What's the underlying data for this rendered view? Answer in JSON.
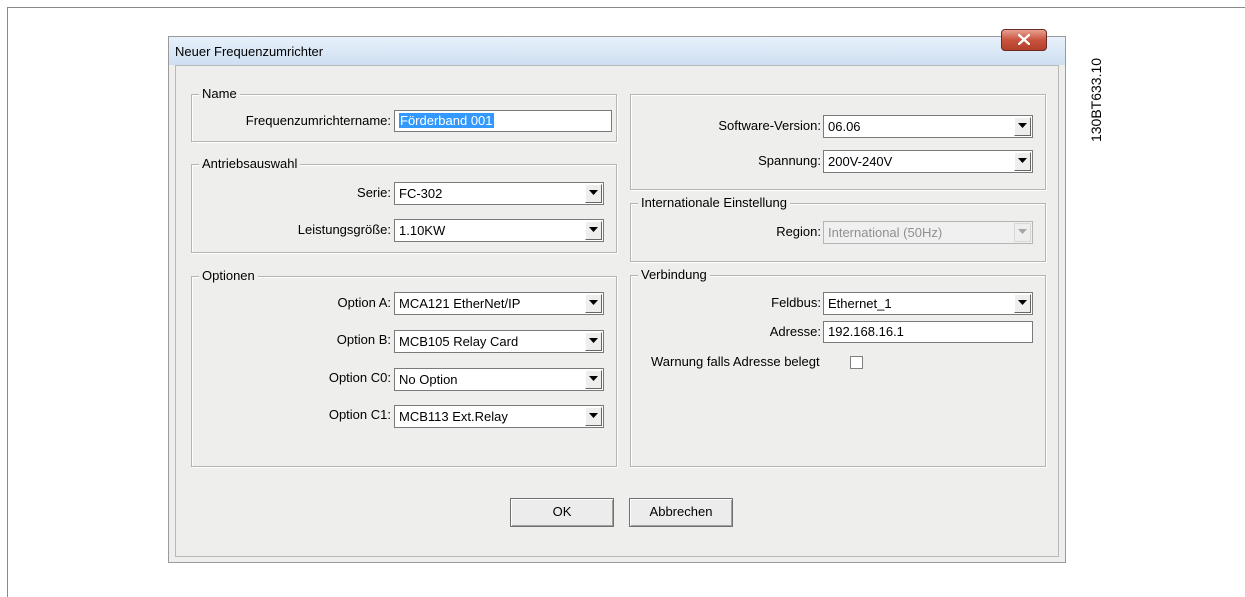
{
  "figure_code": "130BT633.10",
  "dialog": {
    "title": "Neuer Frequenzumrichter",
    "close_glyph": "X"
  },
  "name_group": {
    "legend": "Name",
    "drive_name_label": "Frequenzumrichtername:",
    "drive_name_value": "Förderband 001"
  },
  "drive_group": {
    "legend": "Antriebsauswahl",
    "series_label": "Serie:",
    "series_value": "FC-302",
    "power_label": "Leistungsgröße:",
    "power_value": "1.10KW"
  },
  "options_group": {
    "legend": "Optionen",
    "option_a_label": "Option A:",
    "option_a_value": "MCA121 EtherNet/IP",
    "option_b_label": "Option B:",
    "option_b_value": "MCB105 Relay Card",
    "option_c0_label": "Option C0:",
    "option_c0_value": "No Option",
    "option_c1_label": "Option C1:",
    "option_c1_value": "MCB113 Ext.Relay"
  },
  "version_group": {
    "software_label": "Software-Version:",
    "software_value": "06.06",
    "voltage_label": "Spannung:",
    "voltage_value": "200V-240V"
  },
  "intl_group": {
    "legend": "Internationale Einstellung",
    "region_label": "Region:",
    "region_value": "International (50Hz)",
    "region_enabled": false
  },
  "connection_group": {
    "legend": "Verbindung",
    "fieldbus_label": "Feldbus:",
    "fieldbus_value": "Ethernet_1",
    "address_label": "Adresse:",
    "address_value": "192.168.16.1",
    "warning_label": "Warnung falls Adresse belegt",
    "warning_checked": false
  },
  "buttons": {
    "ok": "OK",
    "cancel": "Abbrechen"
  },
  "colors": {
    "selection": "#3399ff",
    "close_button": "#c9533e",
    "dialog_face": "#eeeeec"
  },
  "icons": {
    "dropdown": "chevron-down-icon",
    "close": "close-icon"
  }
}
